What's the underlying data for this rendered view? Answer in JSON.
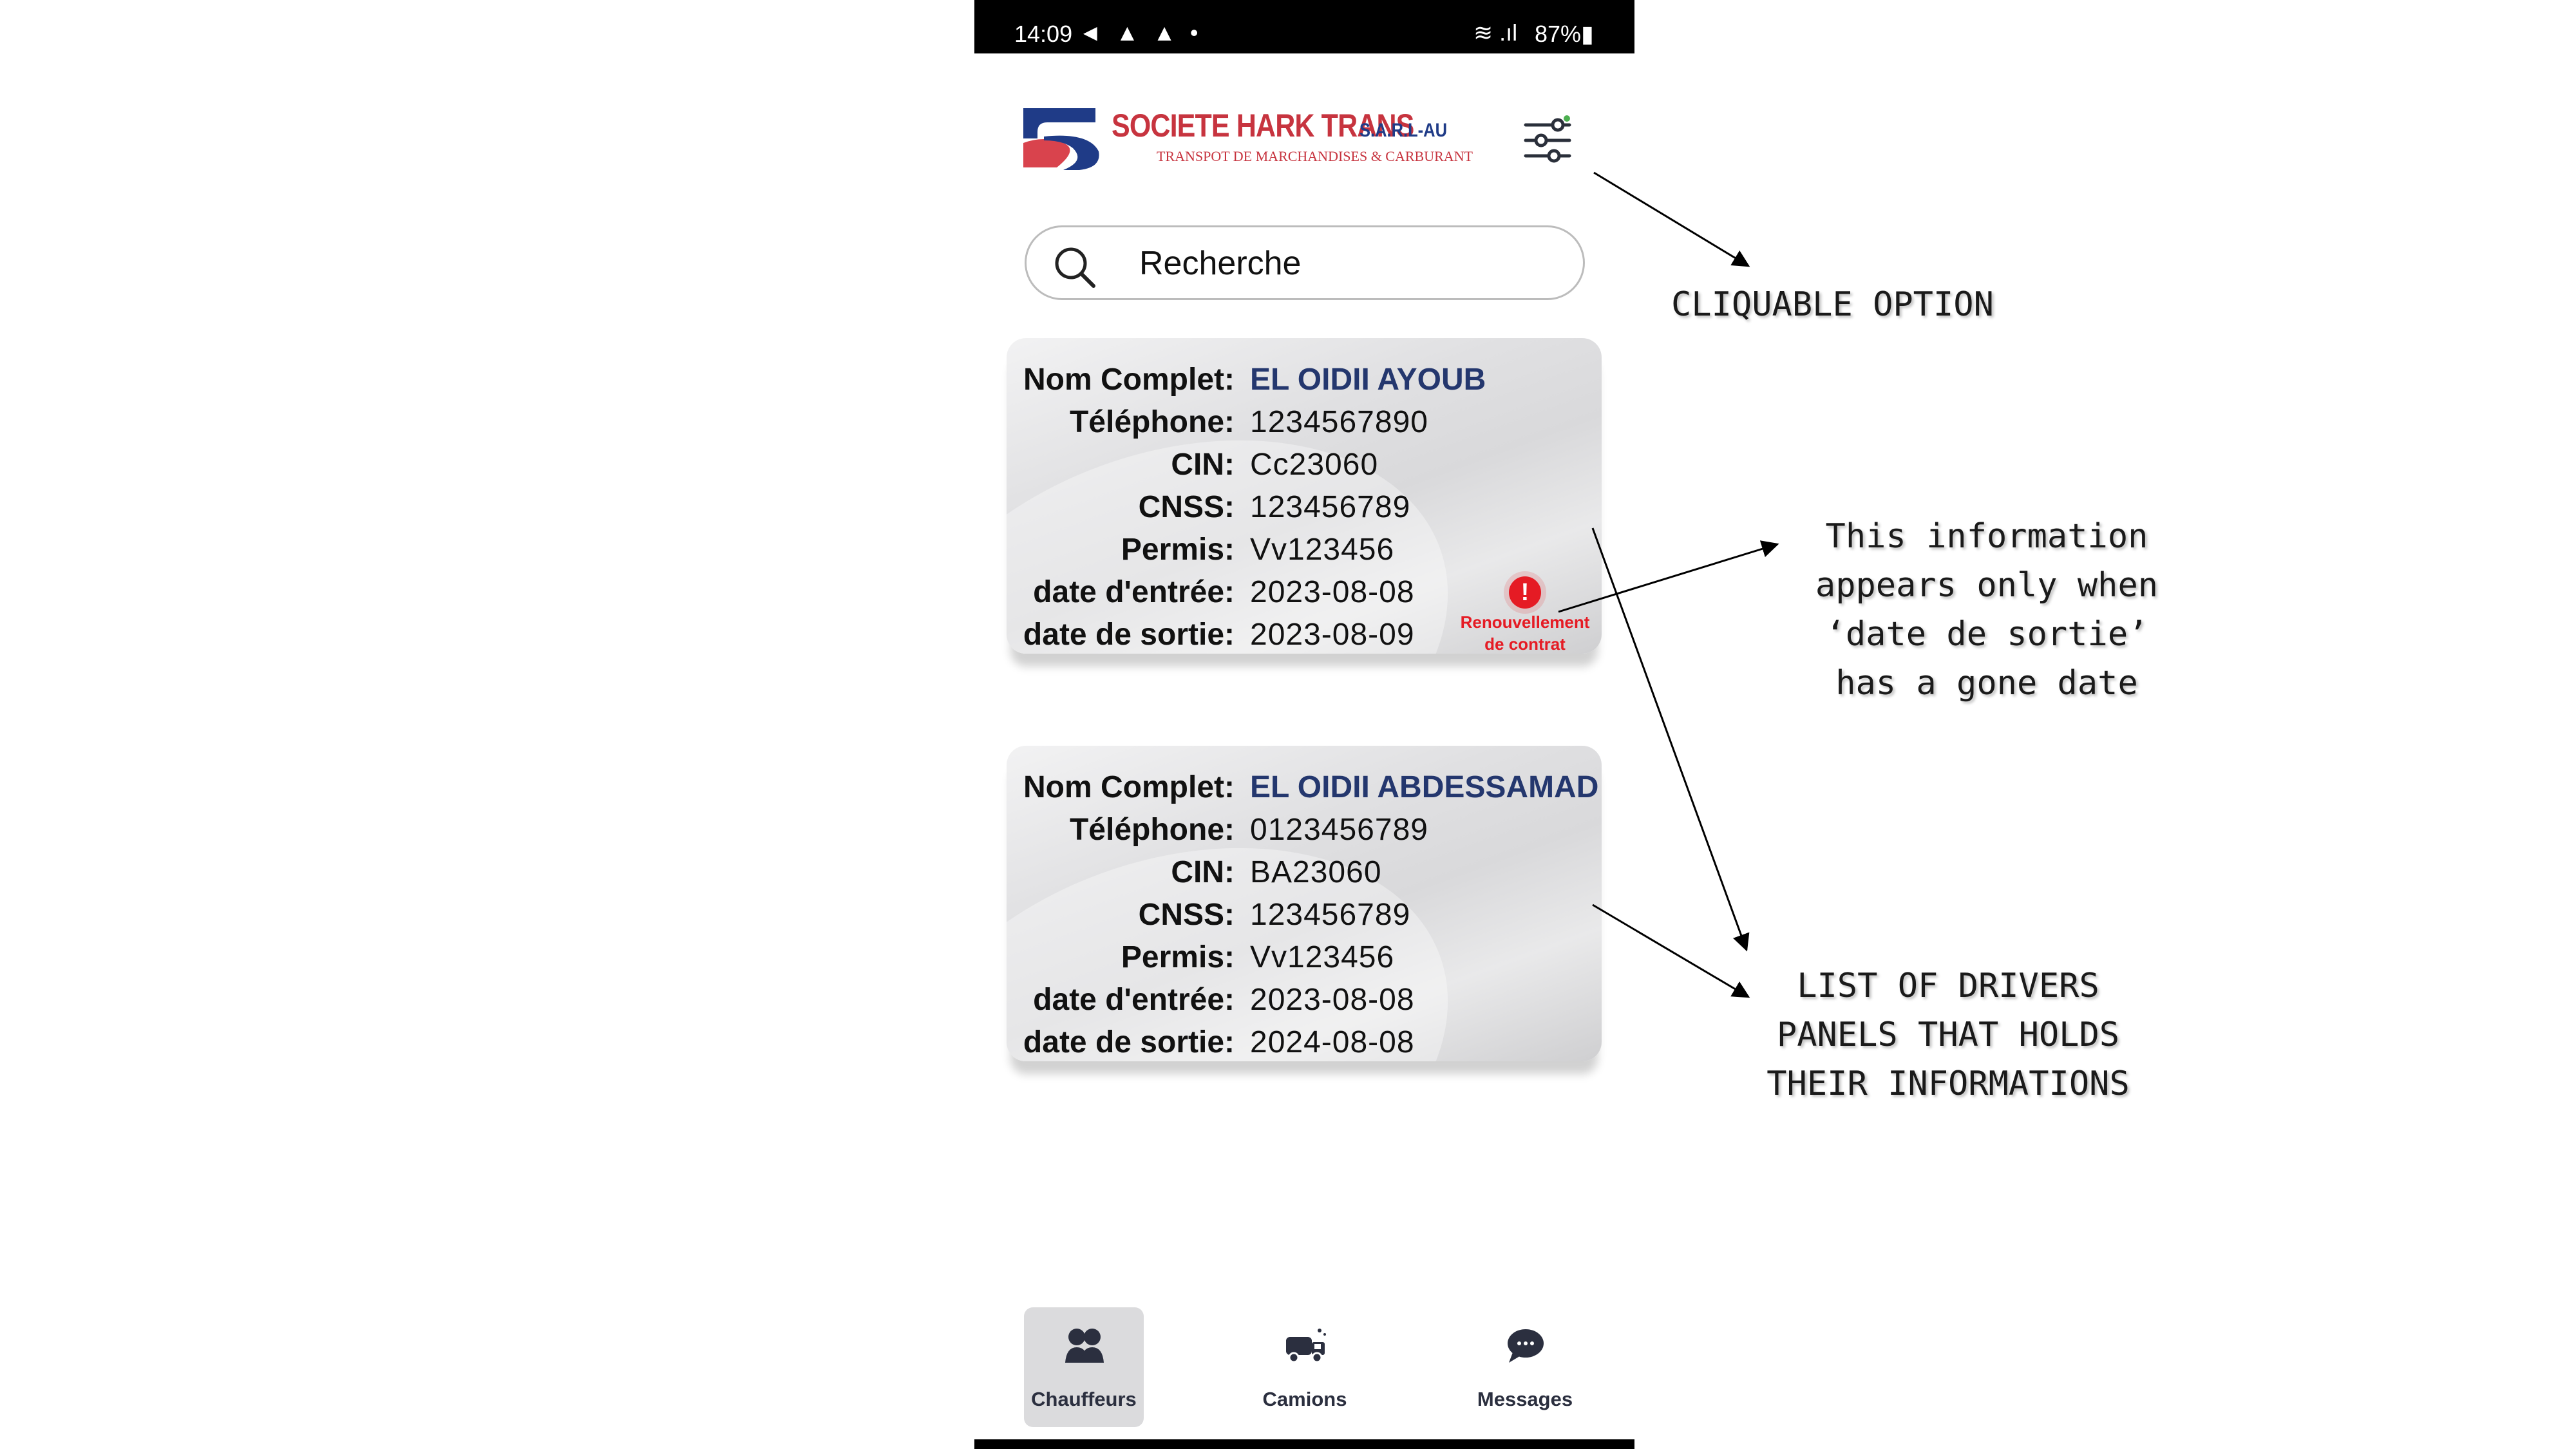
{
  "status_bar": {
    "time": "14:09",
    "left_icons": "◄ ▲ ▲ •",
    "right_icons": "≋ .ıl",
    "battery": "87%▮"
  },
  "header": {
    "logo_title": "SOCIETE HARK TRANS",
    "logo_suffix": "S.A.R.L-AU",
    "logo_subtitle": "TRANSPOT DE MARCHANDISES & CARBURANT",
    "filter_icon": "sliders-icon"
  },
  "search": {
    "placeholder": "Recherche",
    "icon": "search-icon"
  },
  "drivers": [
    {
      "fields": [
        {
          "label": "Nom Complet:",
          "value": "EL OIDII AYOUB"
        },
        {
          "label": "Téléphone:",
          "value": "1234567890"
        },
        {
          "label": "CIN:",
          "value": "Cc23060"
        },
        {
          "label": "CNSS:",
          "value": "123456789"
        },
        {
          "label": "Permis:",
          "value": "Vv123456"
        },
        {
          "label": "date d'entrée:",
          "value": "2023-08-08"
        },
        {
          "label": "date de sortie:",
          "value": "2023-08-09"
        }
      ],
      "alert": {
        "icon": "!",
        "line1": "Renouvellement",
        "line2": "de contrat",
        "color": "#e51b24"
      }
    },
    {
      "fields": [
        {
          "label": "Nom Complet:",
          "value": "EL OIDII ABDESSAMAD"
        },
        {
          "label": "Téléphone:",
          "value": "0123456789"
        },
        {
          "label": "CIN:",
          "value": "BA23060"
        },
        {
          "label": "CNSS:",
          "value": "123456789"
        },
        {
          "label": "Permis:",
          "value": "Vv123456"
        },
        {
          "label": "date d'entrée:",
          "value": "2023-08-08"
        },
        {
          "label": "date de sortie:",
          "value": "2024-08-08"
        }
      ]
    }
  ],
  "bottom_nav": [
    {
      "label": "Chauffeurs",
      "icon": "drivers-icon",
      "active": true
    },
    {
      "label": "Camions",
      "icon": "truck-icon",
      "active": false
    },
    {
      "label": "Messages",
      "icon": "chat-icon",
      "active": false
    }
  ],
  "annotations": {
    "option": "CLIQUABLE OPTION",
    "info_line1": "This information",
    "info_line2": "appears only when",
    "info_line3": "‘date de sortie’",
    "info_line4": "has a gone date",
    "list_line1": "LIST OF DRIVERS",
    "list_line2": "PANELS THAT HOLDS",
    "list_line3": "THEIR INFORMATIONS"
  },
  "colors": {
    "name_value": "#24376e",
    "alert": "#e51b24",
    "brand_red": "#c7343f",
    "brand_blue": "#1f3b87"
  }
}
